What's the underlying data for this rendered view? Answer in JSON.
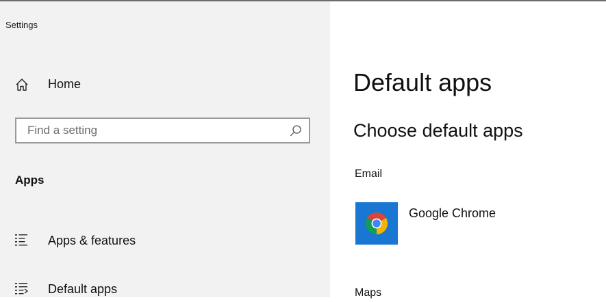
{
  "window": {
    "title": "Settings"
  },
  "sidebar": {
    "home": {
      "icon": "home-icon",
      "label": "Home"
    },
    "search": {
      "placeholder": "Find a setting",
      "value": "",
      "icon": "search-icon"
    },
    "section_heading": "Apps",
    "items": [
      {
        "icon": "apps-features-icon",
        "label": "Apps & features"
      },
      {
        "icon": "default-apps-icon",
        "label": "Default apps"
      }
    ]
  },
  "main": {
    "title": "Default apps",
    "subtitle": "Choose default apps",
    "categories": [
      {
        "label": "Email",
        "app": {
          "name": "Google Chrome",
          "icon": "google-chrome-icon"
        }
      },
      {
        "label": "Maps"
      }
    ]
  },
  "colors": {
    "sidebar_bg": "#f2f2f2",
    "app_tile_bg": "#1976d2",
    "border": "#9a9a9a"
  }
}
